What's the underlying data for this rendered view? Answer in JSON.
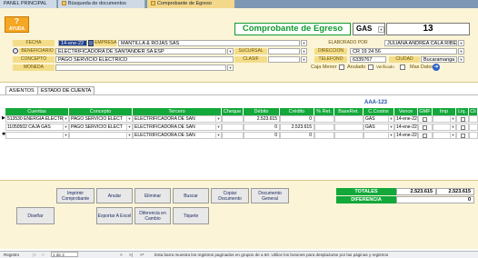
{
  "tabs": [
    "PANEL PRINCIPAL",
    "Búsqueda de documentos",
    "Comprobante de Egreso"
  ],
  "help": {
    "q": "?",
    "label": "AYUDA"
  },
  "title": "Comprobante de Egreso",
  "doc_type": "GAS",
  "doc_number": "13",
  "fields": {
    "fecha_label": "FECHA",
    "fecha": "14-ene-22",
    "empresa_label": "EMPRESA",
    "empresa": "MANTILLA & ROJAS SAS",
    "beneficiario_label": "BENEFICIARIO",
    "beneficiario": "ELECTRIFICADORA DE SANTANDER SA ESP",
    "concepto_label": "CONCEPTO",
    "concepto": "PAGO SERVICIO ELECTRICO",
    "moneda_label": "MONEDA",
    "elaborado_label": "ELABORADO POR",
    "elaborado": "JULIANA ANDREA CALA RIBE",
    "sucursal_label": "SUCURSAL",
    "direccion_label": "DIRECCION",
    "direccion": "CR 19 24 56",
    "telefono_label": "TELEFONO",
    "telefono": "6339767",
    "ciudad_label": "CIUDAD",
    "ciudad": "Bucaramanga",
    "clasif_label": "CLASIF",
    "caja_menor": "Caja Menor",
    "anulado": "Anulado",
    "verificado": "Verificado",
    "mas_datos": "Mas Datos"
  },
  "detail_tabs": [
    "ASIENTOS",
    "ESTADO DE CUENTA"
  ],
  "aaa": "AAA-123",
  "grid": {
    "headers": [
      "Cuentas",
      "Concepto",
      "Tercero",
      "Cheque",
      "Débito",
      "Crédito",
      "% Ret.",
      "BaseRet.",
      "C.Costos",
      "Vence",
      "GMF",
      "Imp",
      "Liq.",
      "Cli"
    ],
    "rows": [
      {
        "cuenta": "513530 ENERGIA ELECTRI",
        "concepto": "PAGO SERVICIO ELECT",
        "tercero": "ELECTRIFICADORA DE SAN",
        "debito": "2.523.615",
        "credito": "0",
        "ccostos": "GAS",
        "vence": "14-ene-22"
      },
      {
        "cuenta": "11050502 CAJA GAS",
        "concepto": "PAGO SERVICIO ELECT",
        "tercero": "ELECTRIFICADORA DE SAN",
        "debito": "0",
        "credito": "2.523.615",
        "ccostos": "GAS",
        "vence": "14-ene-22"
      },
      {
        "cuenta": "",
        "concepto": "",
        "tercero": "ELECTRIFICADORA DE SAN",
        "debito": "0",
        "credito": "0",
        "ccostos": "",
        "vence": "14-ene-22"
      }
    ]
  },
  "buttons": {
    "imprimir": "Imprimir Comprobante",
    "anular": "Anular",
    "eliminar": "Eliminar",
    "buscar": "Buscar",
    "copiar": "Copiar Documento",
    "documento_general": "Documento General",
    "disenar": "Diseñar",
    "exportar": "Exportar A Excel",
    "diferencia": "Diferencia en Cambio",
    "tiquete": "Tiquete"
  },
  "totals": {
    "label": "TOTALES",
    "debito": "2.523.615",
    "credito": "2.523.615",
    "diferencia_label": "DIFERENCIA",
    "diferencia": "0"
  },
  "status": {
    "registro": "Registro",
    "pos": "1 de 2",
    "text": "Esta barra muestra los registros paginados en grupos de a 50. Utilice los botones para desplazarse por las páginas y registros"
  }
}
